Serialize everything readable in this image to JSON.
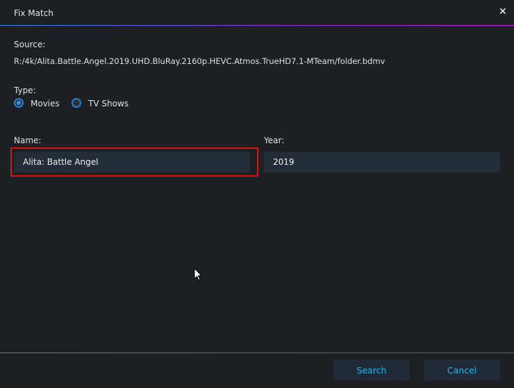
{
  "dialog": {
    "title": "Fix Match",
    "close_icon": "x-icon"
  },
  "source": {
    "label": "Source:",
    "value": "R:/4k/Alita.Battle.Angel.2019.UHD.BluRay.2160p.HEVC.Atmos.TrueHD7.1-MTeam/folder.bdmv"
  },
  "type": {
    "label": "Type:",
    "options": [
      {
        "label": "Movies",
        "selected": true
      },
      {
        "label": "TV Shows",
        "selected": false
      }
    ]
  },
  "name": {
    "label": "Name:",
    "value": "Alita: Battle Angel"
  },
  "year": {
    "label": "Year:",
    "value": "2019"
  },
  "buttons": {
    "search": "Search",
    "cancel": "Cancel"
  },
  "colors": {
    "accent": "#1fb6e8",
    "highlight": "#e01010",
    "background": "#1d1f22"
  }
}
